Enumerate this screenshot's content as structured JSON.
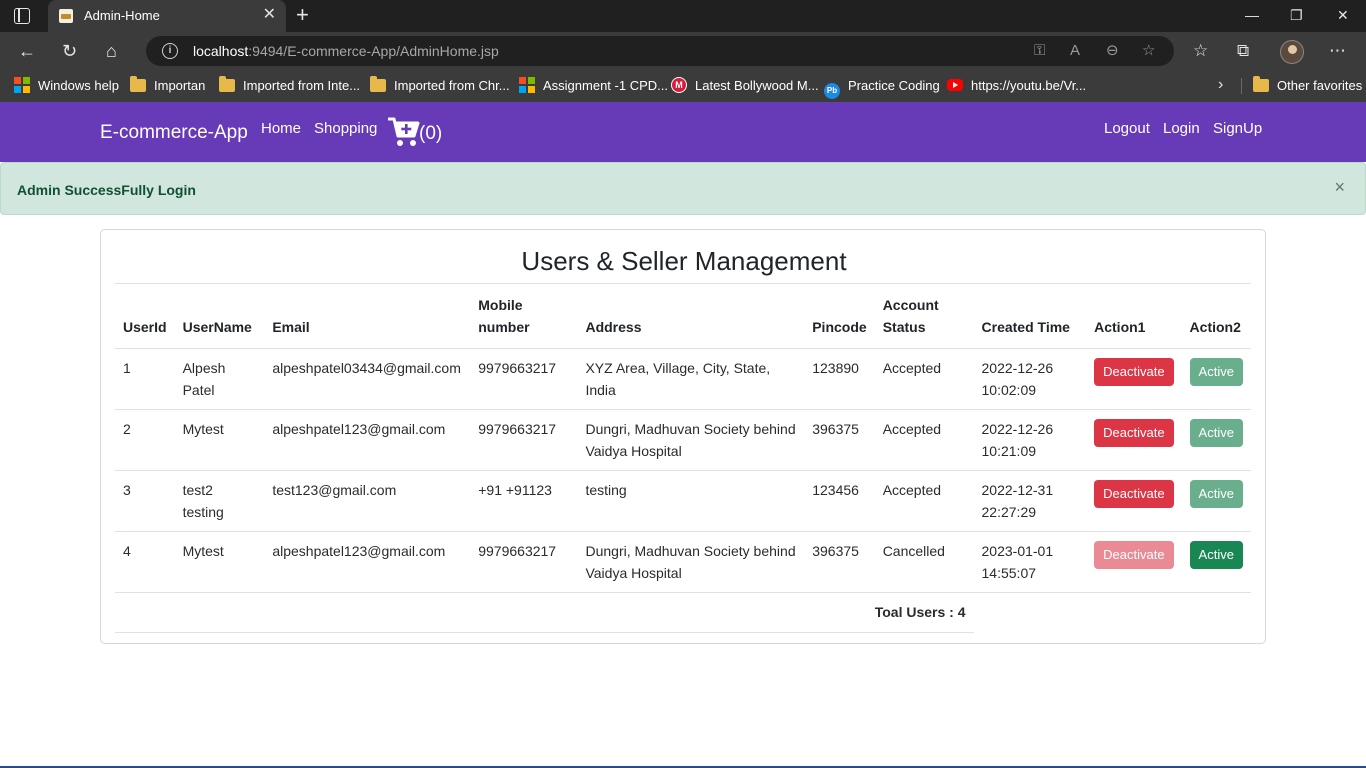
{
  "browser": {
    "tab_title": "Admin-Home",
    "url_host": "localhost",
    "url_rest": ":9494/E-commerce-App/AdminHome.jsp",
    "bookmarks": [
      {
        "label": "Windows help",
        "icon": "windows-icon"
      },
      {
        "label": "Importan",
        "icon": "folder-icon"
      },
      {
        "label": "Imported from Inte...",
        "icon": "folder-icon"
      },
      {
        "label": "Imported from Chr...",
        "icon": "folder-icon"
      },
      {
        "label": "Assignment -1 CPD...",
        "icon": "windows-icon"
      },
      {
        "label": "Latest Bollywood M...",
        "icon": "m-icon"
      },
      {
        "label": "Practice Coding",
        "icon": "pb-icon"
      },
      {
        "label": "https://youtu.be/Vr...",
        "icon": "youtube-icon"
      }
    ],
    "other_favorites": "Other favorites"
  },
  "navbar": {
    "brand": "E-commerce-App",
    "home": "Home",
    "shopping": "Shopping",
    "cart_count": "(0)",
    "logout": "Logout",
    "login": "Login",
    "signup": "SignUp",
    "color": "#673ab7"
  },
  "alert": {
    "message": "Admin SuccessFully Login",
    "close": "×"
  },
  "card": {
    "title": "Users & Seller Management",
    "columns": [
      "UserId",
      "UserName",
      "Email",
      "Mobile number",
      "Address",
      "Pincode",
      "Account Status",
      "Created Time",
      "Action1",
      "Action2"
    ],
    "rows": [
      {
        "id": "1",
        "name": "Alpesh Patel",
        "email": "alpeshpatel03434@gmail.com",
        "mobile": "9979663217",
        "address": "XYZ Area, Village, City, State, India",
        "pincode": "123890",
        "status": "Accepted",
        "created": "2022-12-26 10:02:09",
        "action1": "Deactivate",
        "action2": "Active"
      },
      {
        "id": "2",
        "name": "Mytest",
        "email": "alpeshpatel123@gmail.com",
        "mobile": "9979663217",
        "address": "Dungri, Madhuvan Society behind Vaidya Hospital",
        "pincode": "396375",
        "status": "Accepted",
        "created": "2022-12-26 10:21:09",
        "action1": "Deactivate",
        "action2": "Active"
      },
      {
        "id": "3",
        "name": "test2 testing",
        "email": "test123@gmail.com",
        "mobile": "+91 +91123",
        "address": "testing",
        "pincode": "123456",
        "status": "Accepted",
        "created": "2022-12-31 22:27:29",
        "action1": "Deactivate",
        "action2": "Active"
      },
      {
        "id": "4",
        "name": "Mytest",
        "email": "alpeshpatel123@gmail.com",
        "mobile": "9979663217",
        "address": "Dungri, Madhuvan Society behind Vaidya Hospital",
        "pincode": "396375",
        "status": "Cancelled",
        "created": "2023-01-01 14:55:07",
        "action1": "Deactivate",
        "action2": "Active"
      }
    ],
    "total": "Toal Users : 4"
  }
}
